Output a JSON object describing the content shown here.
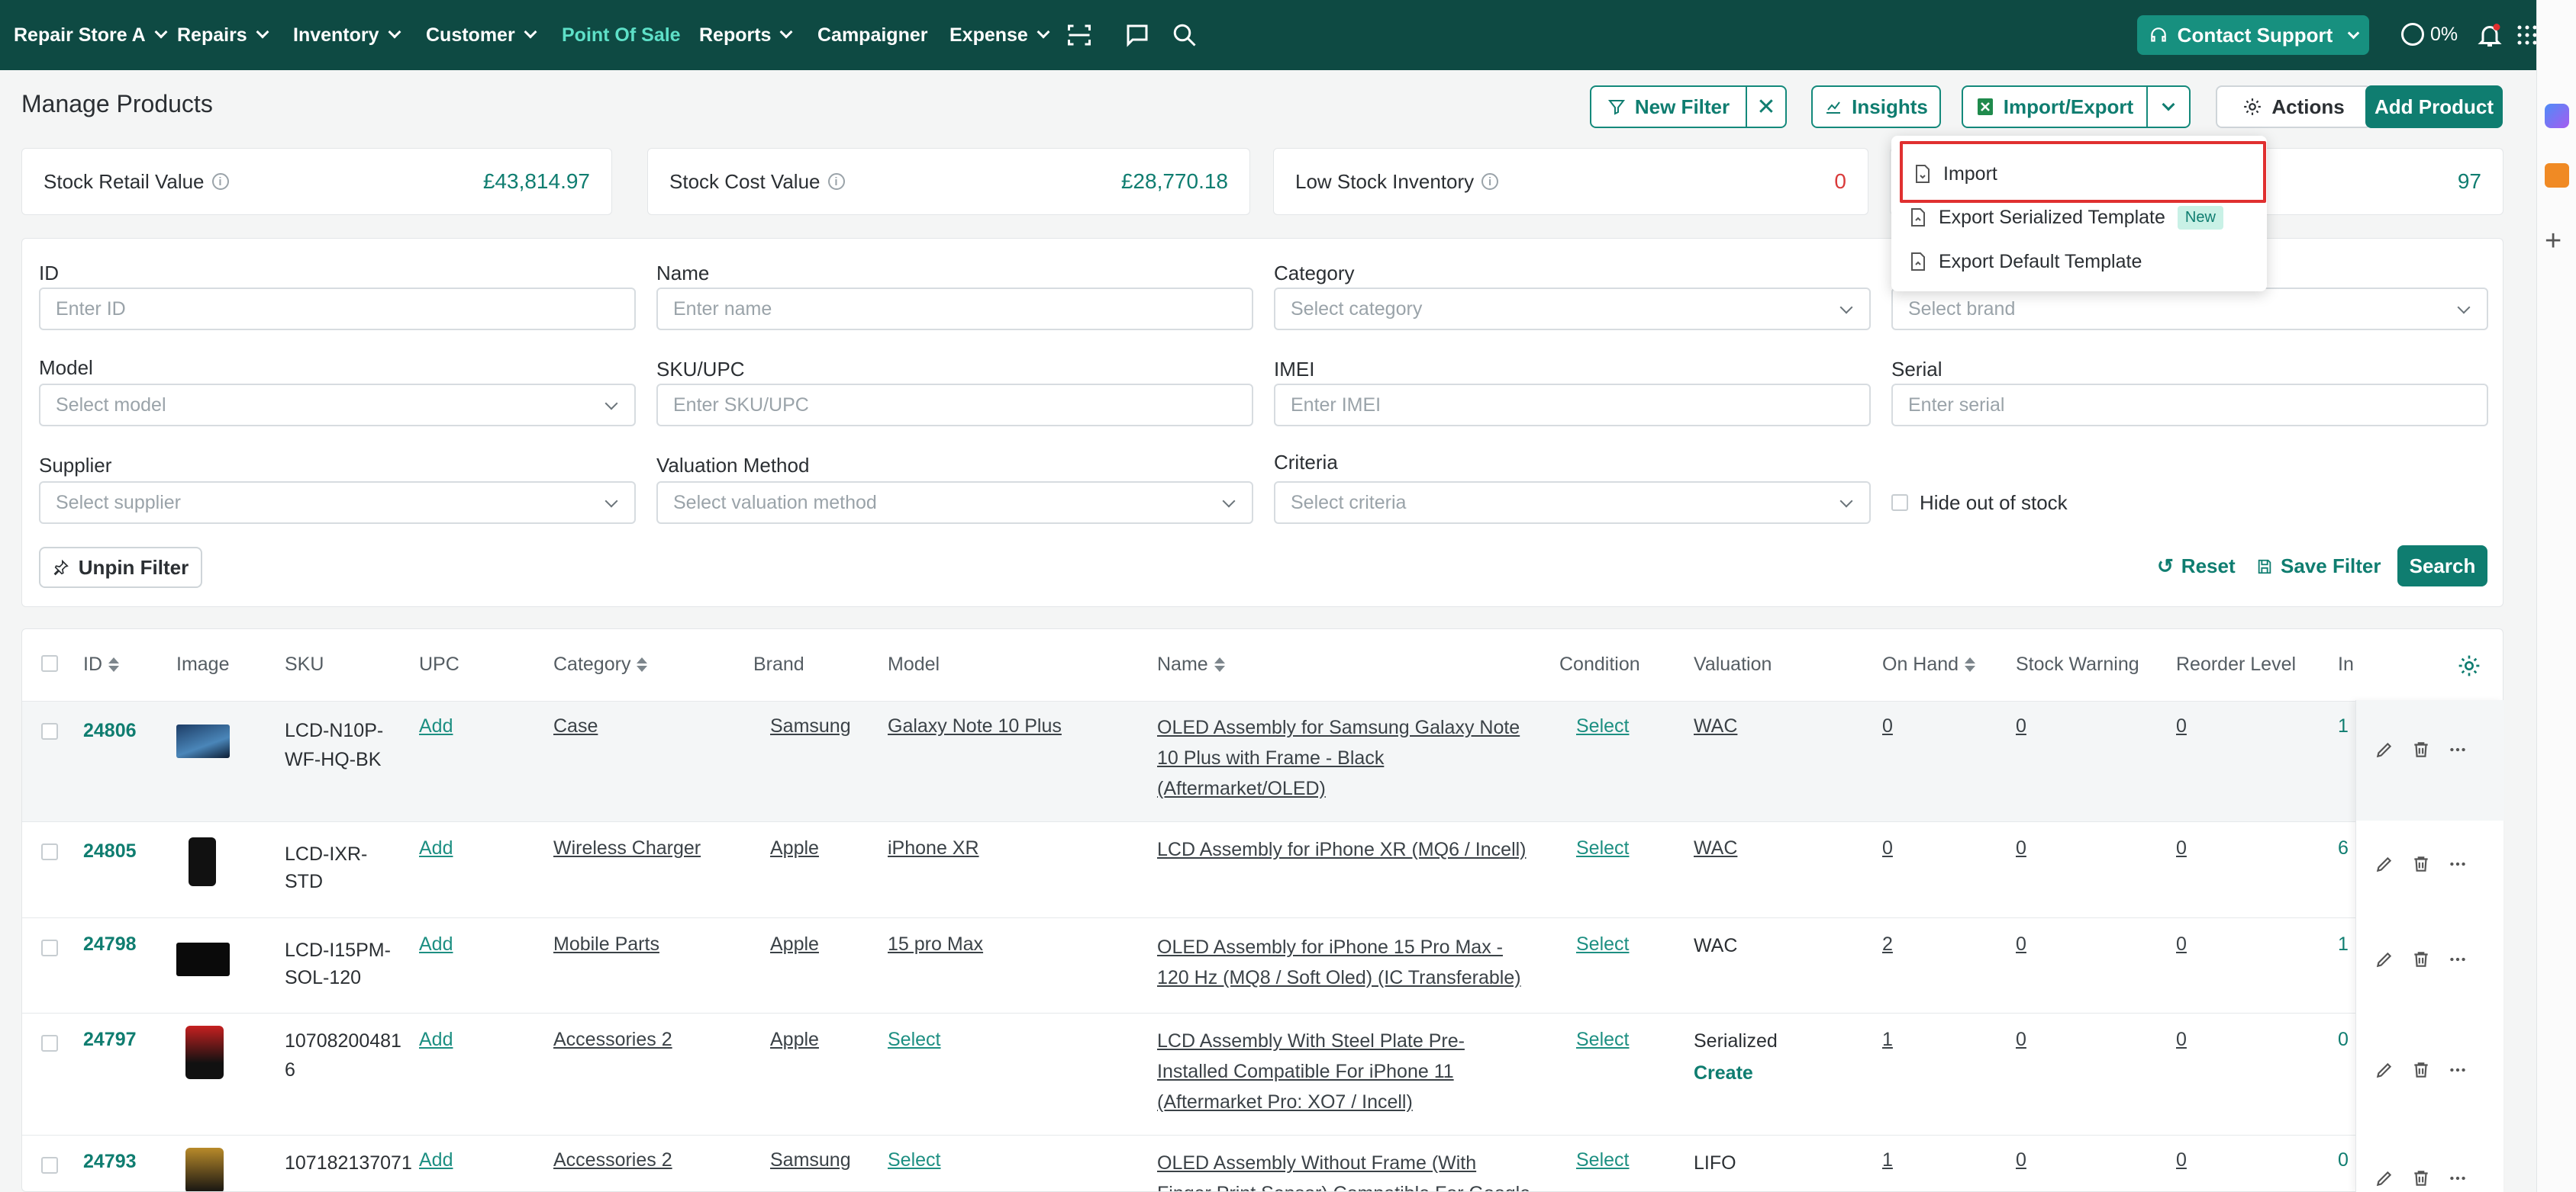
{
  "nav": {
    "store": "Repair Store A",
    "repairs": "Repairs",
    "inventory": "Inventory",
    "customer": "Customer",
    "pos": "Point Of Sale",
    "reports": "Reports",
    "campaigner": "Campaigner",
    "expense": "Expense",
    "contact_support": "Contact Support",
    "progress": "0%"
  },
  "header": {
    "title": "Manage Products",
    "new_filter": "New Filter",
    "insights": "Insights",
    "import_export": "Import/Export",
    "actions": "Actions",
    "add_product": "Add Product"
  },
  "stats": {
    "retail_label": "Stock Retail Value",
    "retail_value": "£43,814.97",
    "cost_label": "Stock Cost Value",
    "cost_value": "£28,770.18",
    "low_label": "Low Stock Inventory",
    "low_value": "0",
    "fourth_value": "97"
  },
  "dropdown": {
    "import": "Import",
    "export_serialized": "Export Serialized Template",
    "new_badge": "New",
    "export_default": "Export Default Template"
  },
  "filters": {
    "id_label": "ID",
    "id_placeholder": "Enter ID",
    "name_label": "Name",
    "name_placeholder": "Enter name",
    "category_label": "Category",
    "category_placeholder": "Select category",
    "brand_placeholder": "Select brand",
    "model_label": "Model",
    "model_placeholder": "Select model",
    "sku_label": "SKU/UPC",
    "sku_placeholder": "Enter SKU/UPC",
    "imei_label": "IMEI",
    "imei_placeholder": "Enter IMEI",
    "serial_label": "Serial",
    "serial_placeholder": "Enter serial",
    "supplier_label": "Supplier",
    "supplier_placeholder": "Select supplier",
    "valuation_label": "Valuation Method",
    "valuation_placeholder": "Select valuation method",
    "criteria_label": "Criteria",
    "criteria_placeholder": "Select criteria",
    "hide_oos": "Hide out of stock",
    "unpin": "Unpin Filter",
    "reset": "Reset",
    "save_filter": "Save Filter",
    "search": "Search"
  },
  "table": {
    "headers": {
      "id": "ID",
      "image": "Image",
      "sku": "SKU",
      "upc": "UPC",
      "category": "Category",
      "brand": "Brand",
      "model": "Model",
      "name": "Name",
      "condition": "Condition",
      "valuation": "Valuation",
      "on_hand": "On Hand",
      "stock_warning": "Stock Warning",
      "reorder_level": "Reorder Level",
      "in": "In"
    },
    "rows": [
      {
        "id": "24806",
        "sku1": "LCD-N10P-",
        "sku2": "WF-HQ-BK",
        "upc": "Add",
        "category": "Case",
        "brand": "Samsung",
        "model": "Galaxy Note 10 Plus",
        "name1": "OLED Assembly for Samsung Galaxy Note",
        "name2": "10 Plus with Frame - Black",
        "name3": "(Aftermarket/OLED)",
        "condition": "Select",
        "valuation": "WAC",
        "valuation2": "",
        "on_hand": "0",
        "stock_warning": "0",
        "reorder": "0",
        "in": "1"
      },
      {
        "id": "24805",
        "sku1": "LCD-IXR-",
        "sku2": "STD",
        "upc": "Add",
        "category": "Wireless Charger",
        "brand": "Apple",
        "model": "iPhone XR",
        "name1": "LCD Assembly for iPhone XR (MQ6 / Incell)",
        "name2": "",
        "name3": "",
        "condition": "Select",
        "valuation": "WAC",
        "valuation2": "",
        "on_hand": "0",
        "stock_warning": "0",
        "reorder": "0",
        "in": "6"
      },
      {
        "id": "24798",
        "sku1": "LCD-I15PM-",
        "sku2": "SOL-120",
        "upc": "Add",
        "category": "Mobile Parts",
        "brand": "Apple",
        "model": "15 pro Max",
        "name1": "OLED Assembly for iPhone 15 Pro Max -",
        "name2": "120 Hz (MQ8 / Soft Oled) (IC Transferable)",
        "name3": "",
        "condition": "Select",
        "valuation": "WAC",
        "valuation2": "",
        "on_hand": "2",
        "stock_warning": "0",
        "reorder": "0",
        "in": "1"
      },
      {
        "id": "24797",
        "sku1": "10708200481",
        "sku2": "6",
        "upc": "Add",
        "category": "Accessories 2",
        "brand": "Apple",
        "model": "Select",
        "name1": "LCD Assembly With Steel Plate Pre-",
        "name2": "Installed Compatible For iPhone 11",
        "name3": "(Aftermarket Pro: XO7 / Incell)",
        "condition": "Select",
        "valuation": "Serialized",
        "valuation2": "Create",
        "on_hand": "1",
        "stock_warning": "0",
        "reorder": "0",
        "in": "0"
      },
      {
        "id": "24793",
        "sku1": "107182137071",
        "sku2": "",
        "upc": "Add",
        "category": "Accessories 2",
        "brand": "Samsung",
        "model": "Select",
        "name1": "OLED Assembly Without Frame (With",
        "name2": "Finger Print Sensor) Compatible For Google",
        "name3": "",
        "condition": "Select",
        "valuation": "LIFO",
        "valuation2": "",
        "on_hand": "1",
        "stock_warning": "0",
        "reorder": "0",
        "in": "0"
      }
    ]
  },
  "colors": {
    "nav_bg": "#0e4a43",
    "accent": "#0f7d70",
    "highlight_border": "#e03030"
  },
  "icons": [
    "scan-icon",
    "chat-icon",
    "search-icon",
    "headset-icon",
    "bell-icon",
    "apps-grid-icon",
    "filter-icon",
    "insights-icon",
    "excel-icon",
    "gear-icon",
    "pin-icon",
    "reset-icon",
    "save-icon",
    "edit-icon",
    "trash-icon",
    "more-icon",
    "file-icon"
  ]
}
